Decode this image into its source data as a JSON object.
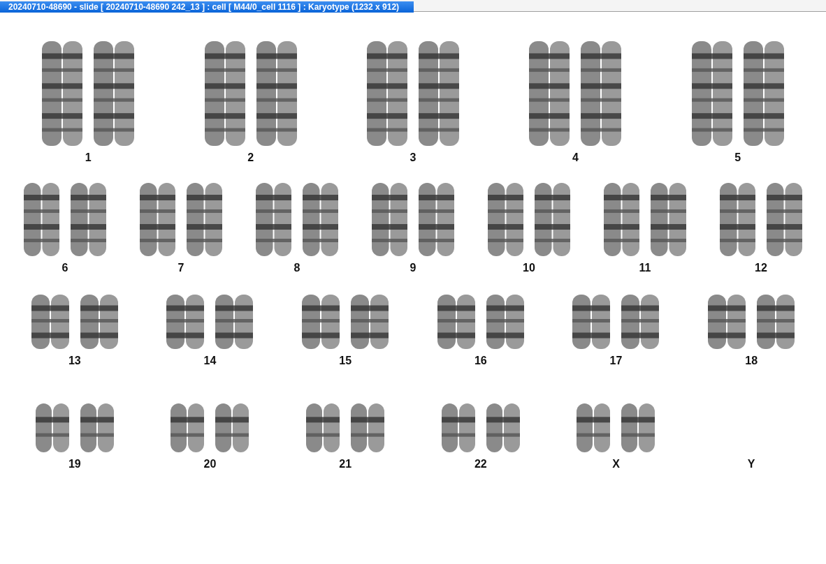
{
  "window": {
    "title": "20240710-48690 - slide [ 20240710-48690 242_13 ] : cell [ M44/0_cell 1116 ] : Karyotype  (1232 x 912)"
  },
  "rows": [
    {
      "groups": [
        {
          "label": "1",
          "kind": "pair"
        },
        {
          "label": "2",
          "kind": "pair"
        },
        {
          "label": "3",
          "kind": "pair"
        },
        {
          "label": "4",
          "kind": "pair"
        },
        {
          "label": "5",
          "kind": "pair"
        }
      ]
    },
    {
      "groups": [
        {
          "label": "6",
          "kind": "pair"
        },
        {
          "label": "7",
          "kind": "pair"
        },
        {
          "label": "8",
          "kind": "pair"
        },
        {
          "label": "9",
          "kind": "pair"
        },
        {
          "label": "10",
          "kind": "pair"
        },
        {
          "label": "11",
          "kind": "pair"
        },
        {
          "label": "12",
          "kind": "pair"
        }
      ]
    },
    {
      "groups": [
        {
          "label": "13",
          "kind": "pair"
        },
        {
          "label": "14",
          "kind": "pair"
        },
        {
          "label": "15",
          "kind": "pair"
        },
        {
          "label": "16",
          "kind": "pair"
        },
        {
          "label": "17",
          "kind": "pair"
        },
        {
          "label": "18",
          "kind": "pair"
        }
      ]
    },
    {
      "groups": [
        {
          "label": "19",
          "kind": "pair"
        },
        {
          "label": "20",
          "kind": "pair"
        },
        {
          "label": "21",
          "kind": "pair"
        },
        {
          "label": "22",
          "kind": "pair"
        },
        {
          "label": "X",
          "kind": "pair"
        },
        {
          "label": "Y",
          "kind": "none"
        }
      ]
    }
  ]
}
